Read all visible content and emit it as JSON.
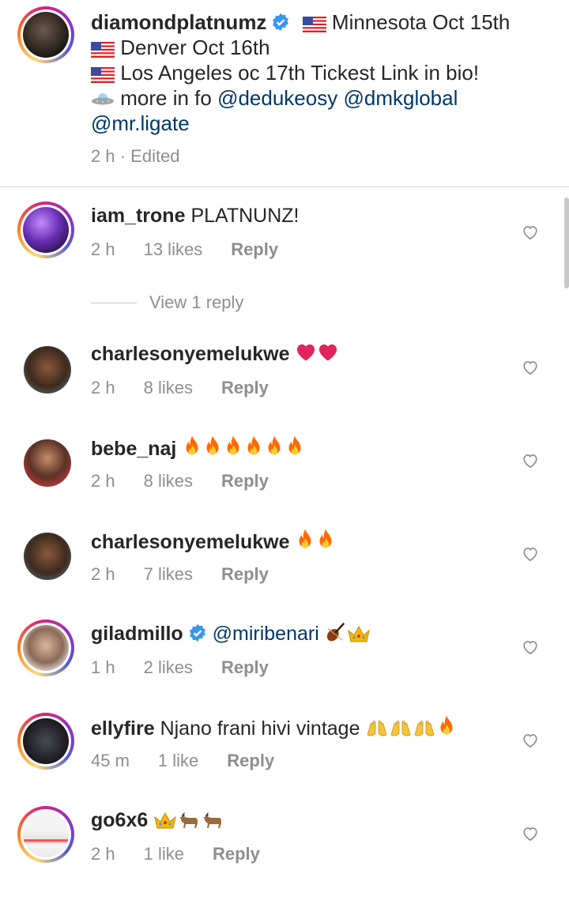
{
  "caption": {
    "username": "diamondplatnumz",
    "line1": "Minnesota Oct 15th",
    "line2": "Denver Oct 16th",
    "line3": "Los Angeles oc 17th  Tickest Link in bio!",
    "line4_prefix": "more in fo",
    "mention1": "@dedukeosy",
    "mention2": "@dmkglobal",
    "mention3": "@mr.ligate",
    "time": "2 h",
    "edited": "Edited"
  },
  "comments": [
    {
      "username": "iam_trone",
      "text": "PLATNUNZ!",
      "time": "2 h",
      "likes": "13 likes",
      "reply": "Reply"
    },
    {
      "username": "charlesonyemelukwe",
      "text": "",
      "time": "2 h",
      "likes": "8 likes",
      "reply": "Reply"
    },
    {
      "username": "bebe_naj",
      "text": "",
      "time": "2 h",
      "likes": "8 likes",
      "reply": "Reply"
    },
    {
      "username": "charlesonyemelukwe",
      "text": "",
      "time": "2 h",
      "likes": "7 likes",
      "reply": "Reply"
    },
    {
      "username": "giladmillo",
      "text": "@miribenari",
      "time": "1 h",
      "likes": "2 likes",
      "reply": "Reply"
    },
    {
      "username": "ellyfire",
      "text": "Njano frani hivi vintage",
      "time": "45 m",
      "likes": "1 like",
      "reply": "Reply"
    },
    {
      "username": "go6x6",
      "text": "",
      "time": "2 h",
      "likes": "1 like",
      "reply": "Reply"
    }
  ],
  "view_reply": "View 1 reply",
  "colors": {
    "mention": "#00376b",
    "meta": "#8e8e8e",
    "verified": "#3897f0",
    "fire": "#ff6a00",
    "heart_red": "#e0245e"
  },
  "icons": [
    "us-flag-icon",
    "ufo-icon",
    "verified-badge-icon",
    "heart-outline-icon",
    "red-heart-emoji",
    "fire-emoji",
    "violin-emoji",
    "crown-emoji",
    "goat-emoji",
    "raised-hands-emoji"
  ]
}
